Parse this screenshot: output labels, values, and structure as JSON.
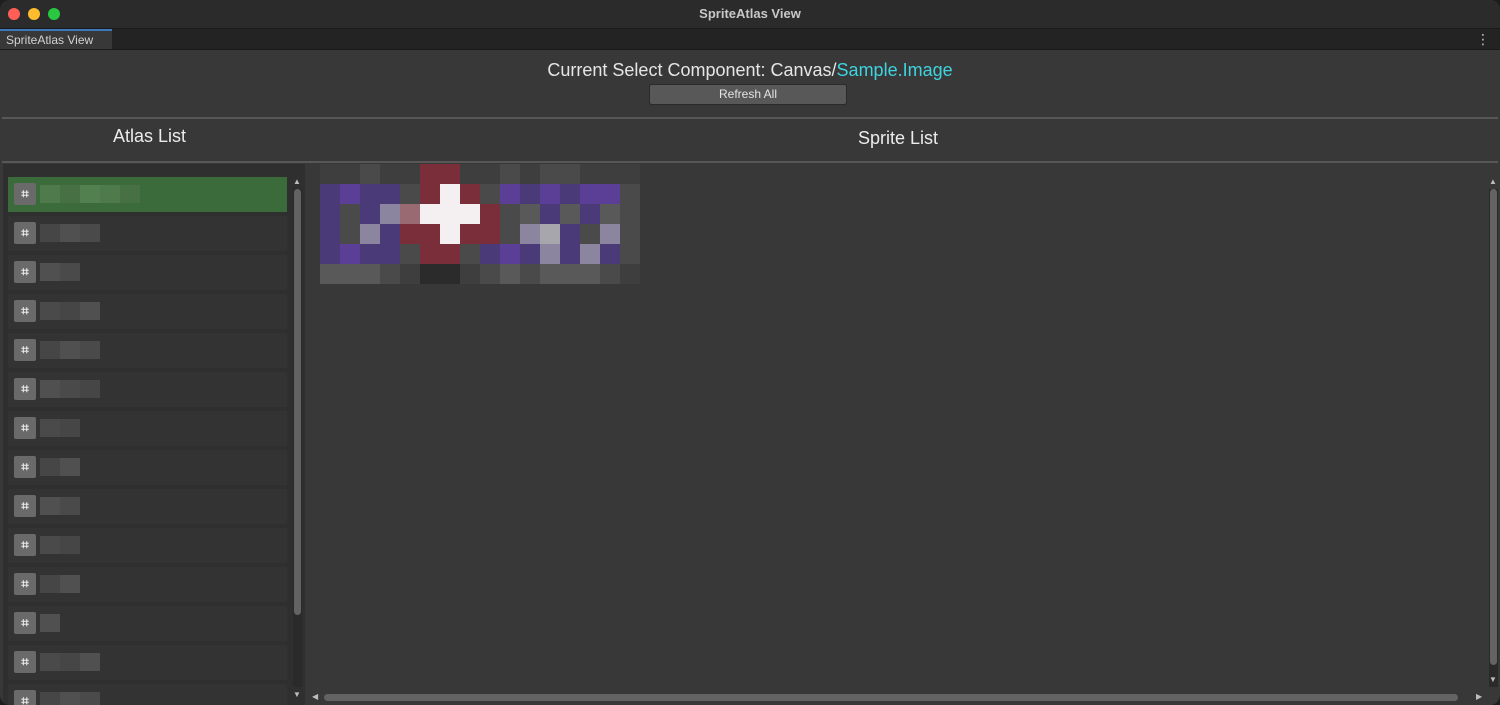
{
  "window": {
    "title": "SpriteAtlas View"
  },
  "tab": {
    "label": "SpriteAtlas View"
  },
  "header": {
    "current_prefix": "Current Select Component: Canvas/",
    "current_highlight": "Sample.Image",
    "refresh_label": "Refresh All"
  },
  "columns": {
    "atlas_title": "Atlas List",
    "sprite_title": "Sprite List"
  },
  "atlas_list": {
    "selected_index": 0,
    "items": [
      "",
      "",
      "",
      "",
      "",
      "",
      "",
      "",
      "",
      "",
      "",
      "",
      "",
      ""
    ]
  },
  "colors": {
    "selected_row": "#3b6b3a",
    "highlight_text": "#3fd3e0",
    "tab_accent": "#3a79bb"
  },
  "icons": {
    "atlas_item": "sprite-atlas-icon",
    "menu": "kebab-menu-icon"
  }
}
